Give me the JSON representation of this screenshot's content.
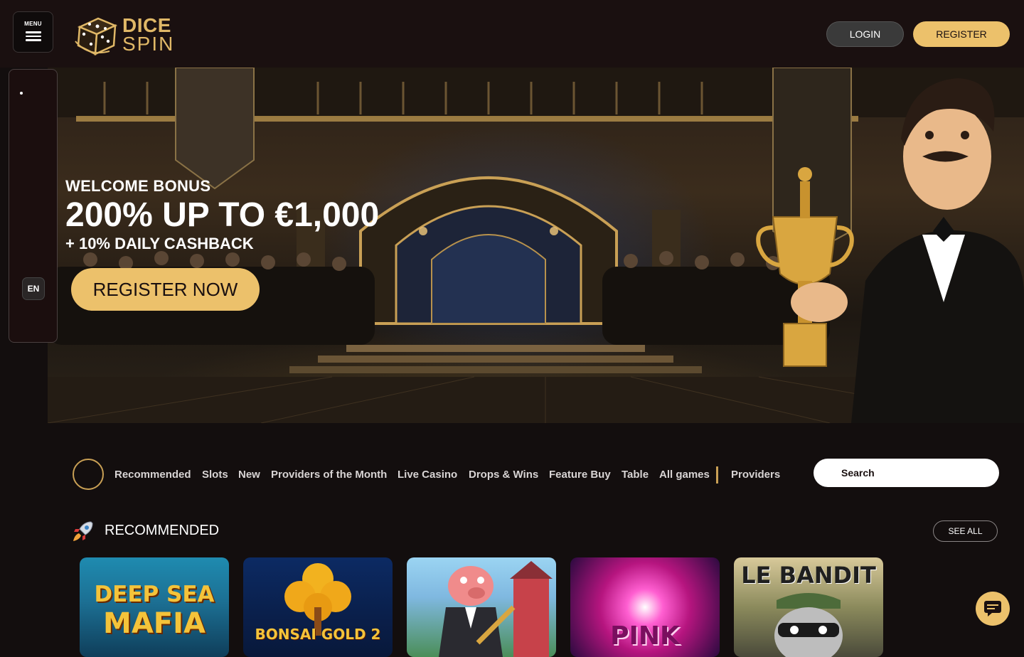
{
  "header": {
    "menu_label": "MENU",
    "logo_line1": "DICE",
    "logo_line2": "SPIN",
    "login_label": "LOGIN",
    "register_label": "REGISTER"
  },
  "side_panel": {
    "language": "EN"
  },
  "hero": {
    "eyebrow": "WELCOME BONUS",
    "headline": "200% UP TO €1,000",
    "subline": "+ 10% DAILY CASHBACK",
    "cta_label": "REGISTER NOW"
  },
  "categories": {
    "items": [
      "Recommended",
      "Slots",
      "New",
      "Providers of the Month",
      "Live Casino",
      "Drops & Wins",
      "Feature Buy",
      "Table",
      "All games"
    ],
    "providers_label": "Providers",
    "search_placeholder": "Search"
  },
  "recommended": {
    "title": "RECOMMENDED",
    "see_all_label": "SEE ALL",
    "games": [
      {
        "line1": "DEEP SEA",
        "line2": "MAFIA"
      },
      {
        "line1": "BONSAI GOLD 2",
        "line2": ""
      },
      {
        "line1": "",
        "line2": ""
      },
      {
        "line1": "PINK",
        "line2": ""
      },
      {
        "line1": "LE BANDIT",
        "line2": ""
      }
    ]
  },
  "icons": {
    "menu": "hamburger-icon",
    "logo": "dice-icon",
    "section": "rocket-icon",
    "chat": "chat-icon"
  },
  "colors": {
    "accent_gold": "#ecc16b",
    "header_bg": "#1a1010",
    "page_bg": "#130e0e"
  }
}
